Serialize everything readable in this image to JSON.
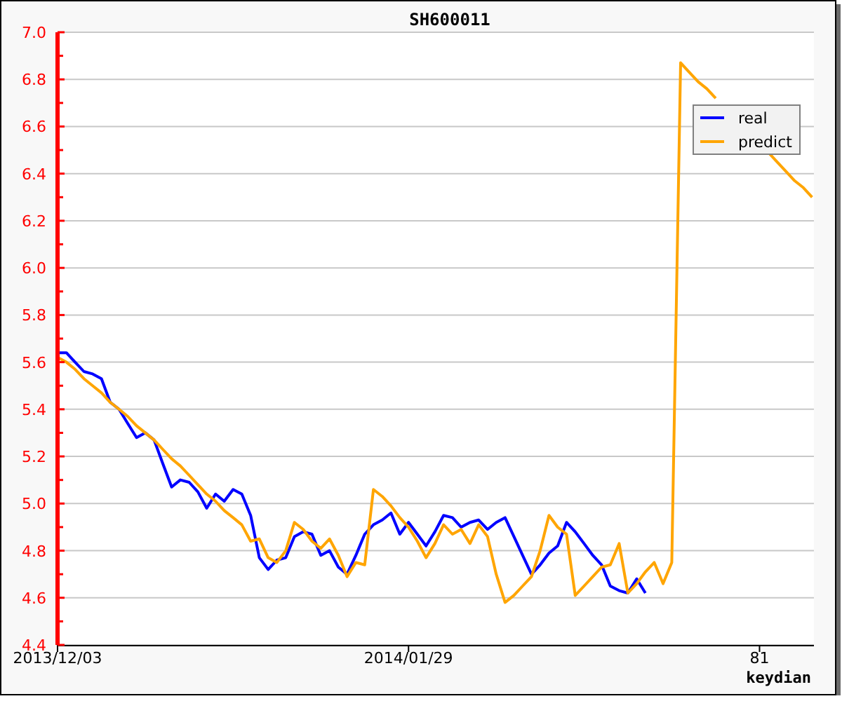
{
  "chart": {
    "chart_data": {
      "type": "line",
      "title": "SH600011",
      "xlabel": "keydian",
      "categories": [
        "2013/12/03",
        null,
        null,
        null,
        null,
        null,
        null,
        null,
        null,
        null,
        null,
        null,
        null,
        null,
        null,
        null,
        null,
        null,
        null,
        null,
        null,
        null,
        null,
        null,
        null,
        null,
        null,
        null,
        null,
        null,
        null,
        null,
        null,
        null,
        null,
        null,
        null,
        null,
        null,
        null,
        "2014/01/29",
        null,
        null,
        null,
        null,
        null,
        null,
        null,
        null,
        null,
        null,
        null,
        null,
        null,
        null,
        null,
        null,
        null,
        null,
        null,
        null,
        null,
        null,
        null,
        null,
        null,
        null,
        null,
        null,
        null,
        null,
        null,
        null,
        null,
        null,
        null,
        null,
        null,
        null,
        null,
        "81",
        null,
        null,
        null,
        null,
        null,
        null
      ],
      "series": [
        {
          "name": "real",
          "color": "#0000ff",
          "values": [
            5.64,
            5.64,
            5.6,
            5.56,
            5.55,
            5.53,
            5.43,
            5.4,
            5.34,
            5.28,
            5.3,
            5.27,
            5.17,
            5.07,
            5.1,
            5.09,
            5.05,
            4.98,
            5.04,
            5.01,
            5.06,
            5.04,
            4.95,
            4.77,
            4.72,
            4.76,
            4.77,
            4.86,
            4.88,
            4.87,
            4.78,
            4.8,
            4.73,
            4.7,
            4.78,
            4.87,
            4.91,
            4.93,
            4.96,
            4.87,
            4.92,
            4.87,
            4.82,
            4.88,
            4.95,
            4.94,
            4.9,
            4.92,
            4.93,
            4.89,
            4.92,
            4.94,
            4.86,
            4.78,
            4.7,
            4.74,
            4.79,
            4.82,
            4.92,
            4.88,
            4.83,
            4.78,
            4.74,
            4.65,
            4.63,
            4.62,
            4.68,
            4.62,
            null,
            null,
            null,
            null,
            null,
            null,
            null,
            null,
            null,
            null,
            null,
            null,
            null,
            null,
            null,
            null,
            null,
            null,
            null
          ]
        },
        {
          "name": "predict",
          "color": "#ffa500",
          "values": [
            5.62,
            5.6,
            5.57,
            5.53,
            5.5,
            5.47,
            5.43,
            5.4,
            5.37,
            5.33,
            5.3,
            5.27,
            5.23,
            5.19,
            5.16,
            5.12,
            5.08,
            5.04,
            5.01,
            4.97,
            4.94,
            4.91,
            4.84,
            4.85,
            4.77,
            4.75,
            4.8,
            4.92,
            4.89,
            4.84,
            4.81,
            4.85,
            4.78,
            4.69,
            4.75,
            4.74,
            5.06,
            5.03,
            4.99,
            4.94,
            4.9,
            4.84,
            4.77,
            4.83,
            4.91,
            4.87,
            4.89,
            4.83,
            4.91,
            4.86,
            4.7,
            4.58,
            4.61,
            4.65,
            4.69,
            4.8,
            4.95,
            4.9,
            4.87,
            4.61,
            4.65,
            4.69,
            4.73,
            4.74,
            4.83,
            4.62,
            4.66,
            4.71,
            4.75,
            4.66,
            4.75,
            6.87,
            6.83,
            6.79,
            6.76,
            6.72,
            null,
            null,
            null,
            null,
            null,
            6.49,
            6.45,
            6.41,
            6.37,
            6.34,
            6.3
          ]
        }
      ],
      "ylim": [
        4.4,
        7.0
      ],
      "grid": true,
      "legend": true,
      "yticks": [
        {
          "value": 4.4,
          "label": "4.4"
        },
        {
          "value": 4.6,
          "label": "4.6"
        },
        {
          "value": 4.8,
          "label": "4.8"
        },
        {
          "value": 5.0,
          "label": "5.0"
        },
        {
          "value": 5.2,
          "label": "5.2"
        },
        {
          "value": 5.4,
          "label": "5.4"
        },
        {
          "value": 5.6,
          "label": "5.6"
        },
        {
          "value": 5.8,
          "label": "5.8"
        },
        {
          "value": 6.0,
          "label": "6.0"
        },
        {
          "value": 6.2,
          "label": "6.2"
        },
        {
          "value": 6.4,
          "label": "6.4"
        },
        {
          "value": 6.6,
          "label": "6.6"
        },
        {
          "value": 6.8,
          "label": "6.8"
        },
        {
          "value": 7.0,
          "label": "7.0"
        }
      ]
    }
  }
}
